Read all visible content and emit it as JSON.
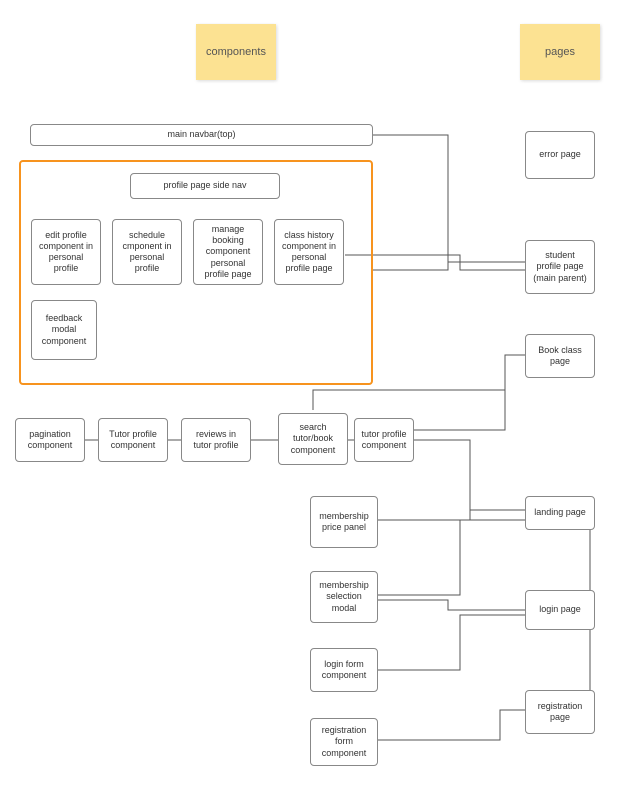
{
  "stickies": {
    "components": "components",
    "pages": "pages"
  },
  "boxes": {
    "main_navbar": "main navbar(top)",
    "profile_side_nav": "profile page side nav",
    "edit_profile": "edit profile component in personal profile",
    "schedule": "schedule cmponent in personal profile",
    "manage_booking": "manage booking component personal profile page",
    "class_history": "class history component in personal profile page",
    "feedback_modal": "feedback modal component",
    "pagination": "pagination component",
    "tutor_profile_1": "Tutor profile component",
    "reviews_tutor": "reviews in tutor profile",
    "search_tutor": "search tutor/book component",
    "tutor_profile_2": "tutor profile component",
    "membership_price": "membership price panel",
    "membership_modal": "membership selection modal",
    "login_form": "login form component",
    "registration_form": "registration form component",
    "error_page": "error page",
    "student_profile": "student profile page (main parent)",
    "book_class": "Book  class page",
    "landing_page": "landing page",
    "login_page": "login page",
    "registration_page": "registration page"
  }
}
